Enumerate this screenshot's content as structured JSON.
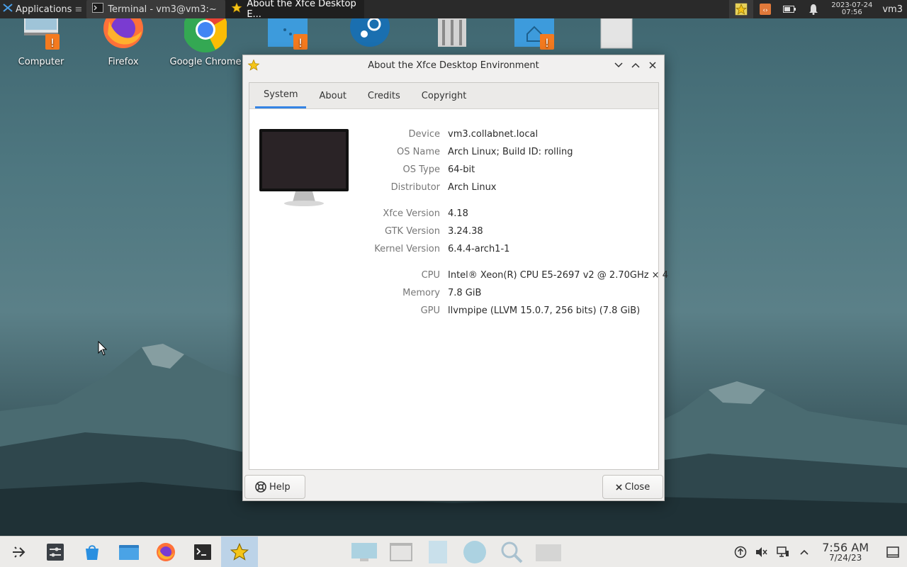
{
  "top_panel": {
    "applications_label": "Applications",
    "tasks": [
      {
        "label": "Terminal - vm3@vm3:~",
        "icon": "terminal-icon"
      },
      {
        "label": "About the Xfce Desktop E...",
        "icon": "star-icon"
      }
    ],
    "clock_date": "2023-07-24",
    "clock_time": "07:56",
    "user": "vm3"
  },
  "desktop_icons": [
    {
      "label": "Computer",
      "icon": "computer-icon"
    },
    {
      "label": "Firefox",
      "icon": "firefox-icon"
    },
    {
      "label": "Google Chrome",
      "icon": "chrome-icon"
    },
    {
      "label": "",
      "icon": "folder-icon"
    },
    {
      "label": "",
      "icon": "steam-icon"
    },
    {
      "label": "",
      "icon": "trash-icon"
    },
    {
      "label": "",
      "icon": "home-folder-icon"
    },
    {
      "label": "",
      "icon": "file-icon"
    }
  ],
  "dialog": {
    "title": "About the Xfce Desktop Environment",
    "tabs": [
      "System",
      "About",
      "Credits",
      "Copyright"
    ],
    "active_tab": "System",
    "fields": [
      {
        "key": "Device",
        "value": "vm3.collabnet.local"
      },
      {
        "key": "OS Name",
        "value": "Arch Linux; Build ID: rolling"
      },
      {
        "key": "OS Type",
        "value": "64-bit"
      },
      {
        "key": "Distributor",
        "value": "Arch Linux"
      },
      {
        "key": "Xfce Version",
        "value": "4.18"
      },
      {
        "key": "GTK Version",
        "value": "3.24.38"
      },
      {
        "key": "Kernel Version",
        "value": "6.4.4-arch1-1"
      },
      {
        "key": "CPU",
        "value": "Intel® Xeon(R) CPU E5-2697 v2 @ 2.70GHz × 4"
      },
      {
        "key": "Memory",
        "value": "7.8 GiB"
      },
      {
        "key": "GPU",
        "value": "llvmpipe (LLVM 15.0.7, 256 bits) (7.8 GiB)"
      }
    ],
    "help_label": "Help",
    "close_label": "Close"
  },
  "bottom_panel": {
    "clock_time": "7:56 AM",
    "clock_date": "7/24/23"
  },
  "colors": {
    "accent": "#3584e4",
    "panel_dark": "#2a2a2a",
    "panel_light": "#ecebe9"
  }
}
